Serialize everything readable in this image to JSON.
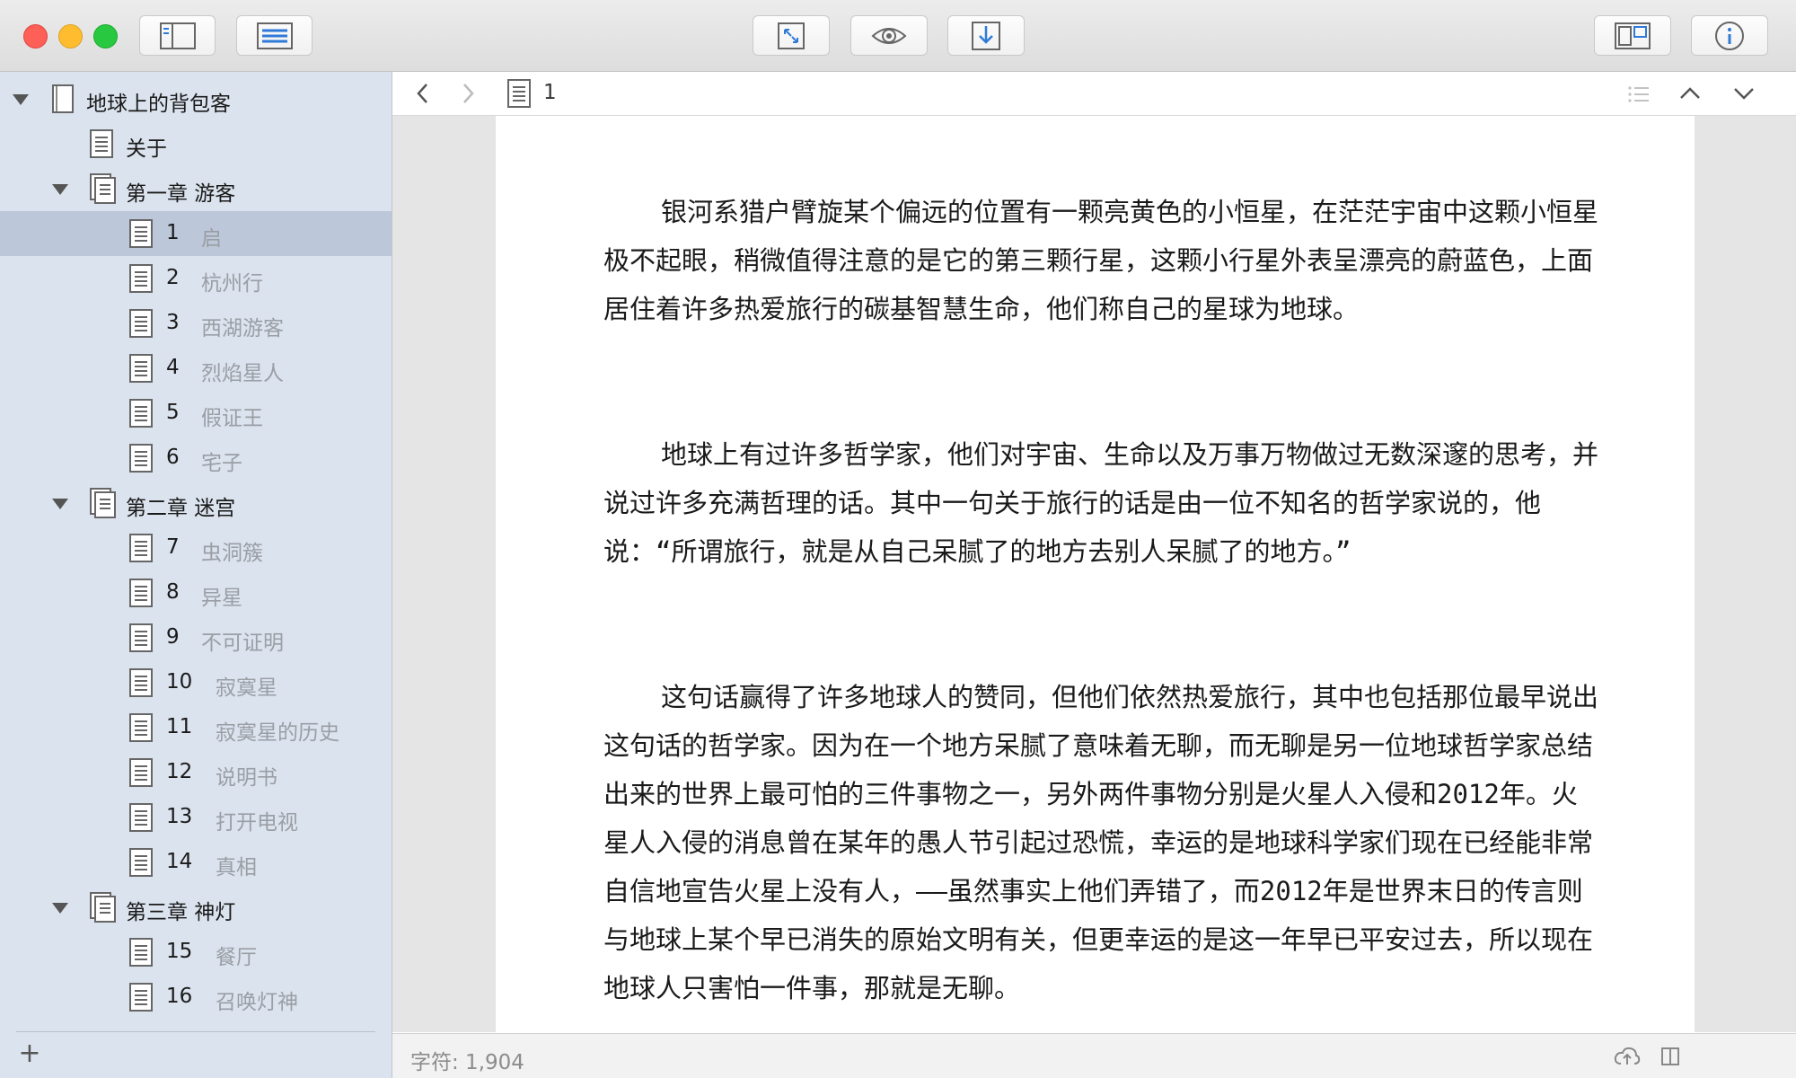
{
  "window": {
    "controls": [
      "close",
      "minimize",
      "zoom"
    ]
  },
  "toolbar": {
    "left_icons": [
      "sidebar-toggle-icon",
      "outline-list-icon"
    ],
    "center_icons": [
      "fullscreen-expand-icon",
      "preview-eye-icon",
      "export-download-icon"
    ],
    "right_icons": [
      "split-layout-icon",
      "info-icon"
    ]
  },
  "sidebar": {
    "book": {
      "title": "地球上的背包客"
    },
    "items": [
      {
        "type": "doc",
        "level": 1,
        "label": "关于"
      },
      {
        "type": "chapter",
        "level": 0,
        "label": "第一章 游客"
      },
      {
        "type": "doc",
        "level": 2,
        "num": "1",
        "title": "启",
        "selected": true
      },
      {
        "type": "doc",
        "level": 2,
        "num": "2",
        "title": "杭州行"
      },
      {
        "type": "doc",
        "level": 2,
        "num": "3",
        "title": "西湖游客"
      },
      {
        "type": "doc",
        "level": 2,
        "num": "4",
        "title": "烈焰星人"
      },
      {
        "type": "doc",
        "level": 2,
        "num": "5",
        "title": "假证王"
      },
      {
        "type": "doc",
        "level": 2,
        "num": "6",
        "title": "宅子"
      },
      {
        "type": "chapter",
        "level": 0,
        "label": "第二章 迷宫"
      },
      {
        "type": "doc",
        "level": 2,
        "num": "7",
        "title": "虫洞簇"
      },
      {
        "type": "doc",
        "level": 2,
        "num": "8",
        "title": "异星"
      },
      {
        "type": "doc",
        "level": 2,
        "num": "9",
        "title": "不可证明"
      },
      {
        "type": "doc",
        "level": 2,
        "num": "10",
        "title": "寂寞星"
      },
      {
        "type": "doc",
        "level": 2,
        "num": "11",
        "title": "寂寞星的历史"
      },
      {
        "type": "doc",
        "level": 2,
        "num": "12",
        "title": "说明书"
      },
      {
        "type": "doc",
        "level": 2,
        "num": "13",
        "title": "打开电视"
      },
      {
        "type": "doc",
        "level": 2,
        "num": "14",
        "title": "真相"
      },
      {
        "type": "chapter",
        "level": 0,
        "label": "第三章 神灯"
      },
      {
        "type": "doc",
        "level": 2,
        "num": "15",
        "title": "餐厅"
      },
      {
        "type": "doc",
        "level": 2,
        "num": "16",
        "title": "召唤灯神"
      }
    ],
    "add_label": "+"
  },
  "navbar": {
    "doc_title": "1"
  },
  "editor": {
    "paragraphs": [
      "银河系猎户臂旋某个偏远的位置有一颗亮黄色的小恒星，在茫茫宇宙中这颗小恒星极不起眼，稍微值得注意的是它的第三颗行星，这颗小行星外表呈漂亮的蔚蓝色，上面居住着许多热爱旅行的碳基智慧生命，他们称自己的星球为地球。",
      "地球上有过许多哲学家，他们对宇宙、生命以及万事万物做过无数深邃的思考，并说过许多充满哲理的话。其中一句关于旅行的话是由一位不知名的哲学家说的，他说：“所谓旅行，就是从自己呆腻了的地方去别人呆腻了的地方。”",
      "这句话赢得了许多地球人的赞同，但他们依然热爱旅行，其中也包括那位最早说出这句话的哲学家。因为在一个地方呆腻了意味着无聊，而无聊是另一位地球哲学家总结出来的世界上最可怕的三件事物之一，另外两件事物分别是火星人入侵和2012年。火星人入侵的消息曾在某年的愚人节引起过恐慌，幸运的是地球科学家们现在已经能非常自信地宣告火星上没有人，——虽然事实上他们弄错了，而2012年是世界末日的传言则与地球上某个早已消失的原始文明有关，但更幸运的是这一年早已平安过去，所以现在地球人只害怕一件事，那就是无聊。"
    ]
  },
  "footer": {
    "word_count": "字符: 1,904"
  },
  "colors": {
    "sidebar_bg": "#dbe3ee",
    "selected_row": "#bcc7d9",
    "accent_blue": "#2f7ad8"
  }
}
